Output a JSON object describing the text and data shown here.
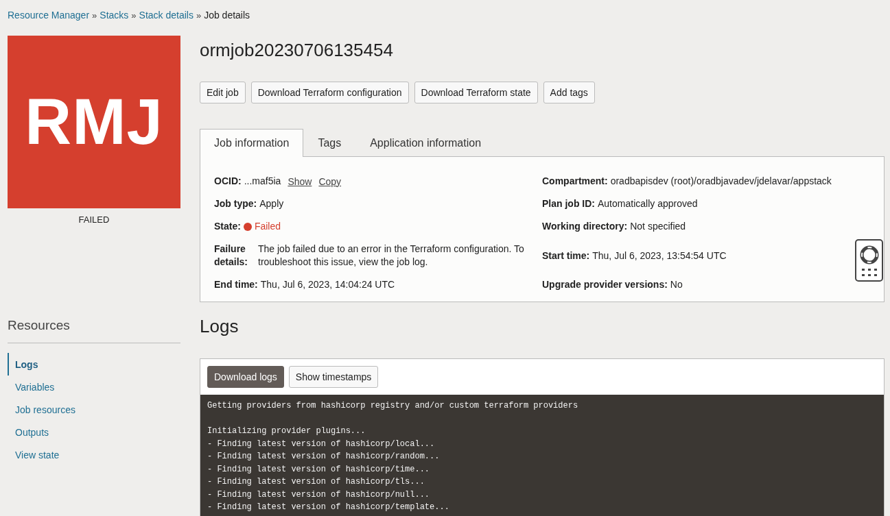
{
  "breadcrumb": [
    {
      "label": "Resource Manager",
      "link": true,
      "separator": "»"
    },
    {
      "label": "Stacks",
      "link": true,
      "separator": "»"
    },
    {
      "label": "Stack details",
      "link": true,
      "separator": "»"
    },
    {
      "label": "Job details",
      "link": false
    }
  ],
  "badge": {
    "text": "RMJ",
    "color": "#d53f2e",
    "status": "FAILED"
  },
  "title": "ormjob20230706135454",
  "actions": [
    "Edit job",
    "Download Terraform configuration",
    "Download Terraform state",
    "Add tags"
  ],
  "tabs": [
    {
      "label": "Job information",
      "selected": true
    },
    {
      "label": "Tags",
      "selected": false
    },
    {
      "label": "Application information",
      "selected": false
    }
  ],
  "details": [
    {
      "kind": "ocid",
      "label": "OCID:",
      "value": "...maf5ia",
      "links": [
        "Show",
        "Copy"
      ]
    },
    {
      "kind": "text",
      "label": "Compartment:",
      "value": "oradbapisdev (root)/oradbjavadev/jdelavar/appstack"
    },
    {
      "kind": "text",
      "label": "Job type:",
      "value": "Apply"
    },
    {
      "kind": "text",
      "label": "Plan job ID:",
      "value": "Automatically approved"
    },
    {
      "kind": "state",
      "label": "State:",
      "value": "Failed",
      "color": "#d53f2e"
    },
    {
      "kind": "text",
      "label": "Working directory:",
      "value": "Not specified"
    },
    {
      "kind": "block",
      "label": "Failure details:",
      "value": "The job failed due to an error in the Terraform configuration. To troubleshoot this issue, view the job log."
    },
    {
      "kind": "text",
      "label": "Start time:",
      "value": "Thu, Jul 6, 2023, 13:54:54 UTC"
    },
    {
      "kind": "text",
      "label": "End time:",
      "value": "Thu, Jul 6, 2023, 14:04:24 UTC"
    },
    {
      "kind": "text",
      "label": "Upgrade provider versions:",
      "value": "No"
    }
  ],
  "resources": {
    "heading": "Resources",
    "items": [
      {
        "label": "Logs",
        "selected": true
      },
      {
        "label": "Variables",
        "selected": false
      },
      {
        "label": "Job resources",
        "selected": false
      },
      {
        "label": "Outputs",
        "selected": false
      },
      {
        "label": "View state",
        "selected": false
      }
    ]
  },
  "logs": {
    "heading": "Logs",
    "buttons": [
      {
        "label": "Download logs",
        "primary": true
      },
      {
        "label": "Show timestamps",
        "primary": false
      }
    ],
    "blocks": [
      {
        "lines": [
          "Getting providers from hashicorp registry and/or custom terraform providers"
        ]
      },
      {
        "lines": [
          "Initializing provider plugins...",
          "- Finding latest version of hashicorp/local...",
          "- Finding latest version of hashicorp/random...",
          "- Finding latest version of hashicorp/time...",
          "- Finding latest version of hashicorp/tls...",
          "- Finding latest version of hashicorp/null...",
          "- Finding latest version of hashicorp/template..."
        ]
      }
    ]
  }
}
